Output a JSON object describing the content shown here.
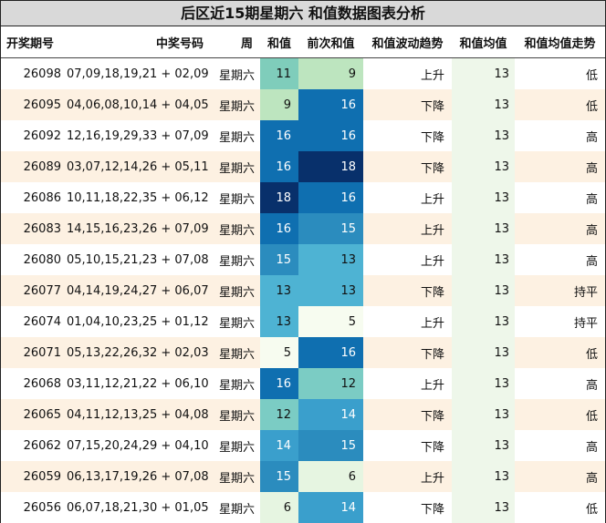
{
  "title": "后区近15期星期六 和值数据图表分析",
  "headers": {
    "issue": "开奖期号",
    "numbers": "中奖号码",
    "week": "周",
    "sum": "和值",
    "prev_sum": "前次和值",
    "trend": "和值波动趋势",
    "avg": "和值均值",
    "avg_trend": "和值均值走势"
  },
  "colors": {
    "5": "#f7fcf0",
    "6": "#e6f5e1",
    "9": "#bde5bf",
    "12": "#7bccc4",
    "13": "#4eb3d3",
    "14": "#3a9fcc",
    "15": "#2b8cbe",
    "16": "#0f6fb0",
    "18": "#08306b",
    "alt_row": "#fdf1e2",
    "avg_col": "#eef7ea"
  },
  "rows": [
    {
      "issue": "26098",
      "numbers": "07,09,18,19,21 + 02,09",
      "week": "星期六",
      "sum": "11",
      "prev_sum": "9",
      "trend": "上升",
      "avg": "13",
      "avg_trend": "低",
      "sum_color": "#7fcdbb",
      "prev_color": "#bde5bf"
    },
    {
      "issue": "26095",
      "numbers": "04,06,08,10,14 + 04,05",
      "week": "星期六",
      "sum": "9",
      "prev_sum": "16",
      "trend": "下降",
      "avg": "13",
      "avg_trend": "低",
      "sum_color": "#bde5bf",
      "prev_color": "#0f6fb0"
    },
    {
      "issue": "26092",
      "numbers": "12,16,19,29,33 + 07,09",
      "week": "星期六",
      "sum": "16",
      "prev_sum": "16",
      "trend": "下降",
      "avg": "13",
      "avg_trend": "高",
      "sum_color": "#0f6fb0",
      "prev_color": "#0f6fb0"
    },
    {
      "issue": "26089",
      "numbers": "03,07,12,14,26 + 05,11",
      "week": "星期六",
      "sum": "16",
      "prev_sum": "18",
      "trend": "下降",
      "avg": "13",
      "avg_trend": "高",
      "sum_color": "#0f6fb0",
      "prev_color": "#08306b"
    },
    {
      "issue": "26086",
      "numbers": "10,11,18,22,35 + 06,12",
      "week": "星期六",
      "sum": "18",
      "prev_sum": "16",
      "trend": "上升",
      "avg": "13",
      "avg_trend": "高",
      "sum_color": "#08306b",
      "prev_color": "#0f6fb0"
    },
    {
      "issue": "26083",
      "numbers": "14,15,16,23,26 + 07,09",
      "week": "星期六",
      "sum": "16",
      "prev_sum": "15",
      "trend": "上升",
      "avg": "13",
      "avg_trend": "高",
      "sum_color": "#0f6fb0",
      "prev_color": "#2b8cbe"
    },
    {
      "issue": "26080",
      "numbers": "05,10,15,21,23 + 07,08",
      "week": "星期六",
      "sum": "15",
      "prev_sum": "13",
      "trend": "上升",
      "avg": "13",
      "avg_trend": "高",
      "sum_color": "#2b8cbe",
      "prev_color": "#4eb3d3"
    },
    {
      "issue": "26077",
      "numbers": "04,14,19,24,27 + 06,07",
      "week": "星期六",
      "sum": "13",
      "prev_sum": "13",
      "trend": "下降",
      "avg": "13",
      "avg_trend": "持平",
      "sum_color": "#4eb3d3",
      "prev_color": "#4eb3d3"
    },
    {
      "issue": "26074",
      "numbers": "01,04,10,23,25 + 01,12",
      "week": "星期六",
      "sum": "13",
      "prev_sum": "5",
      "trend": "上升",
      "avg": "13",
      "avg_trend": "持平",
      "sum_color": "#4eb3d3",
      "prev_color": "#f7fcf0"
    },
    {
      "issue": "26071",
      "numbers": "05,13,22,26,32 + 02,03",
      "week": "星期六",
      "sum": "5",
      "prev_sum": "16",
      "trend": "下降",
      "avg": "13",
      "avg_trend": "低",
      "sum_color": "#f7fcf0",
      "prev_color": "#0f6fb0"
    },
    {
      "issue": "26068",
      "numbers": "03,11,12,21,22 + 06,10",
      "week": "星期六",
      "sum": "16",
      "prev_sum": "12",
      "trend": "上升",
      "avg": "13",
      "avg_trend": "高",
      "sum_color": "#0f6fb0",
      "prev_color": "#7bccc4"
    },
    {
      "issue": "26065",
      "numbers": "04,11,12,13,25 + 04,08",
      "week": "星期六",
      "sum": "12",
      "prev_sum": "14",
      "trend": "下降",
      "avg": "13",
      "avg_trend": "低",
      "sum_color": "#7bccc4",
      "prev_color": "#3a9fcc"
    },
    {
      "issue": "26062",
      "numbers": "07,15,20,24,29 + 04,10",
      "week": "星期六",
      "sum": "14",
      "prev_sum": "15",
      "trend": "下降",
      "avg": "13",
      "avg_trend": "高",
      "sum_color": "#3a9fcc",
      "prev_color": "#2b8cbe"
    },
    {
      "issue": "26059",
      "numbers": "06,13,17,19,26 + 07,08",
      "week": "星期六",
      "sum": "15",
      "prev_sum": "6",
      "trend": "上升",
      "avg": "13",
      "avg_trend": "高",
      "sum_color": "#2b8cbe",
      "prev_color": "#e6f5e1"
    },
    {
      "issue": "26056",
      "numbers": "06,07,18,21,30 + 01,05",
      "week": "星期六",
      "sum": "6",
      "prev_sum": "14",
      "trend": "下降",
      "avg": "13",
      "avg_trend": "低",
      "sum_color": "#e6f5e1",
      "prev_color": "#3a9fcc"
    }
  ]
}
